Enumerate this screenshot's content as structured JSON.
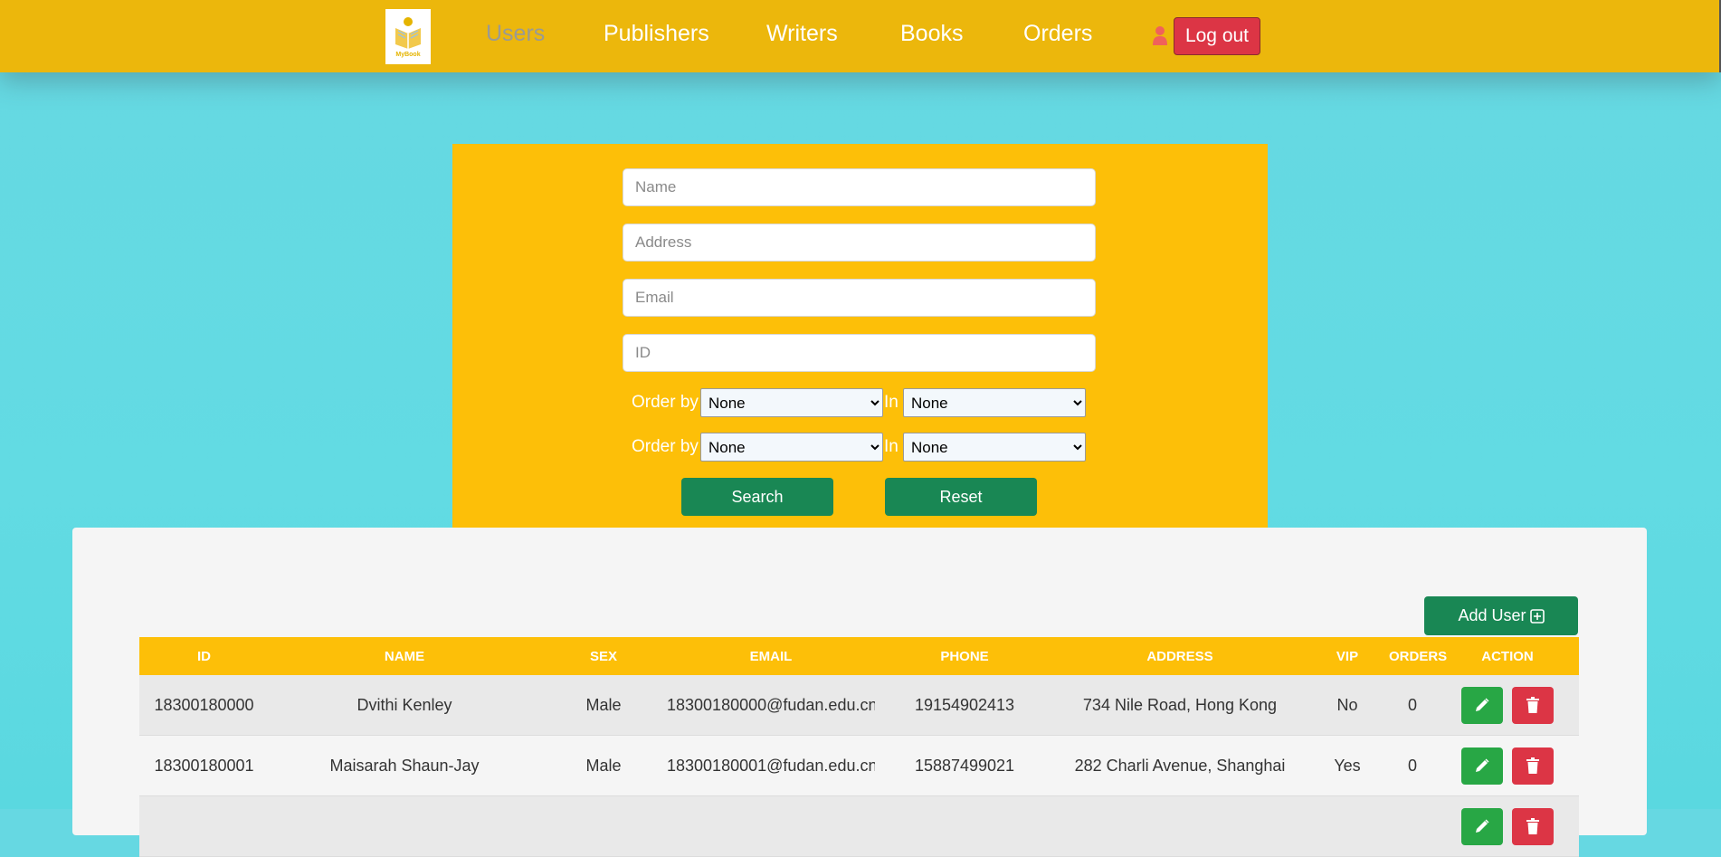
{
  "navbar": {
    "logo_text": "MyBook",
    "links": [
      "Users",
      "Publishers",
      "Writers",
      "Books",
      "Orders"
    ],
    "active": "Users",
    "logout_label": "Log out"
  },
  "search": {
    "name_placeholder": "Name",
    "address_placeholder": "Address",
    "email_placeholder": "Email",
    "id_placeholder": "ID",
    "order_label": "Order by",
    "in_label": "In",
    "order_rows": [
      {
        "order_by": "None",
        "in": "None"
      },
      {
        "order_by": "None",
        "in": "None"
      }
    ],
    "search_label": "Search",
    "reset_label": "Reset"
  },
  "table": {
    "add_user_label": "Add User",
    "headers": [
      "ID",
      "NAME",
      "SEX",
      "EMAIL",
      "PHONE",
      "ADDRESS",
      "VIP",
      "ORDERS",
      "ACTION"
    ],
    "rows": [
      {
        "id": "18300180000",
        "name": "Dvithi Kenley",
        "sex": "Male",
        "email": "18300180000@fudan.edu.cn",
        "phone": "19154902413",
        "address": "734 Nile Road, Hong Kong",
        "vip": "No",
        "orders": "0"
      },
      {
        "id": "18300180001",
        "name": "Maisarah Shaun-Jay",
        "sex": "Male",
        "email": "18300180001@fudan.edu.cn",
        "phone": "15887499021",
        "address": "282 Charli Avenue, Shanghai",
        "vip": "Yes",
        "orders": "0"
      },
      {
        "id": "",
        "name": "",
        "sex": "",
        "email": "",
        "phone": "",
        "address": "",
        "vip": "",
        "orders": ""
      }
    ]
  },
  "colors": {
    "navbar": "#ecb70c",
    "panel": "#fdbf08",
    "primary_green": "#198754",
    "danger_red": "#dc3545",
    "background_cyan": "#62dbe3"
  }
}
